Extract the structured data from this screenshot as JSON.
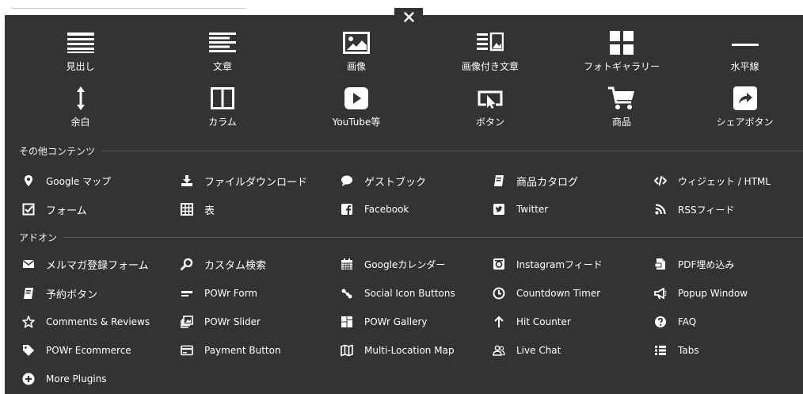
{
  "close_label": "×",
  "big_rows": [
    [
      {
        "label": "見出し",
        "icon": "heading-icon"
      },
      {
        "label": "文章",
        "icon": "text-icon"
      },
      {
        "label": "画像",
        "icon": "image-icon"
      },
      {
        "label": "画像付き文章",
        "icon": "image-text-icon"
      },
      {
        "label": "フォトギャラリー",
        "icon": "gallery-icon"
      },
      {
        "label": "水平線",
        "icon": "horizontal-line-icon"
      }
    ],
    [
      {
        "label": "余白",
        "icon": "spacer-icon"
      },
      {
        "label": "カラム",
        "icon": "columns-icon"
      },
      {
        "label": "YouTube等",
        "icon": "play-icon"
      },
      {
        "label": "ボタン",
        "icon": "button-cursor-icon"
      },
      {
        "label": "商品",
        "icon": "cart-icon"
      },
      {
        "label": "シェアボタン",
        "icon": "share-icon"
      }
    ]
  ],
  "sections": {
    "other": "その他コンテンツ",
    "addons": "アドオン"
  },
  "other_items": [
    [
      {
        "label": "Google マップ",
        "icon": "map-pin-icon"
      },
      {
        "label": "ファイルダウンロード",
        "icon": "download-icon"
      },
      {
        "label": "ゲストブック",
        "icon": "comment-icon"
      },
      {
        "label": "商品カタログ",
        "icon": "catalog-icon"
      },
      {
        "label": "ウィジェット / HTML",
        "icon": "code-icon"
      }
    ],
    [
      {
        "label": "フォーム",
        "icon": "check-square-icon"
      },
      {
        "label": "表",
        "icon": "table-icon"
      },
      {
        "label": "Facebook",
        "icon": "facebook-icon"
      },
      {
        "label": "Twitter",
        "icon": "twitter-icon"
      },
      {
        "label": "RSSフィード",
        "icon": "rss-icon"
      }
    ]
  ],
  "addon_items": [
    [
      {
        "label": "メルマガ登録フォーム",
        "icon": "envelope-icon"
      },
      {
        "label": "カスタム検索",
        "icon": "search-icon"
      },
      {
        "label": "Googleカレンダー",
        "icon": "calendar-icon"
      },
      {
        "label": "Instagramフィード",
        "icon": "instagram-icon"
      },
      {
        "label": "PDF埋め込み",
        "icon": "pdf-icon"
      }
    ],
    [
      {
        "label": "予約ボタン",
        "icon": "reserve-icon"
      },
      {
        "label": "POWr Form",
        "icon": "form-lines-icon"
      },
      {
        "label": "Social Icon Buttons",
        "icon": "share-nodes-icon"
      },
      {
        "label": "Countdown Timer",
        "icon": "clock-icon"
      },
      {
        "label": "Popup Window",
        "icon": "megaphone-icon"
      }
    ],
    [
      {
        "label": "Comments & Reviews",
        "icon": "star-icon"
      },
      {
        "label": "POWr Slider",
        "icon": "slider-icon"
      },
      {
        "label": "POWr Gallery",
        "icon": "grid-gallery-icon"
      },
      {
        "label": "Hit Counter",
        "icon": "arrow-up-icon"
      },
      {
        "label": "FAQ",
        "icon": "question-icon"
      }
    ],
    [
      {
        "label": "POWr Ecommerce",
        "icon": "tag-icon"
      },
      {
        "label": "Payment Button",
        "icon": "credit-card-icon"
      },
      {
        "label": "Multi-Location Map",
        "icon": "map-icon"
      },
      {
        "label": "Live Chat",
        "icon": "users-icon"
      },
      {
        "label": "Tabs",
        "icon": "list-icon"
      }
    ],
    [
      {
        "label": "More Plugins",
        "icon": "plus-circle-icon"
      }
    ]
  ]
}
